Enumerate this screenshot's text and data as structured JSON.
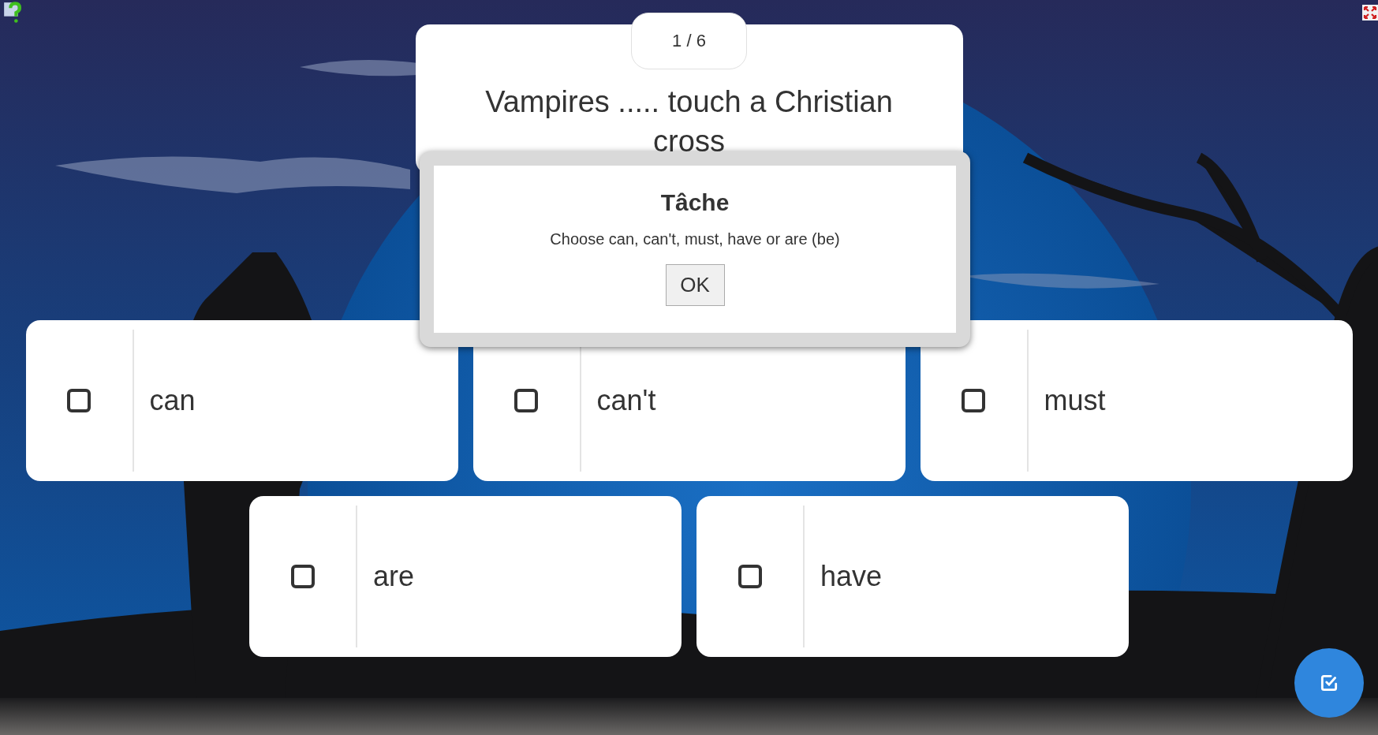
{
  "quiz": {
    "counter": "1 / 6",
    "question": "Vampires ..... touch a Christian cross"
  },
  "options": [
    {
      "label": "can",
      "checked": false
    },
    {
      "label": "can't",
      "checked": false
    },
    {
      "label": "must",
      "checked": false
    },
    {
      "label": "are",
      "checked": false
    },
    {
      "label": "have",
      "checked": false
    }
  ],
  "dialog": {
    "title": "Tâche",
    "message": "Choose can, can't, must, have or are (be)",
    "button": "OK"
  }
}
